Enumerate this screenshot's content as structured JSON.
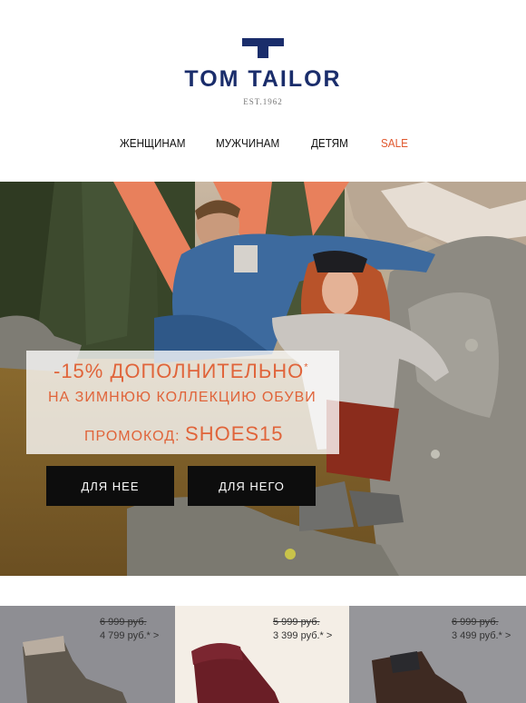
{
  "brand": {
    "name": "TOM TAILOR",
    "established": "EST.1962"
  },
  "nav": {
    "women": "ЖЕНЩИНАМ",
    "men": "МУЖЧИНАМ",
    "kids": "ДЕТЯМ",
    "sale": "SALE"
  },
  "promo": {
    "headline": "-15% ДОПОЛНИТЕЛЬНО",
    "asterisk": "*",
    "subline": "НА ЗИМНЮЮ КОЛЛЕКЦИЮ ОБУВИ",
    "code_label": "ПРОМОКОД:",
    "code": "SHOES15"
  },
  "buttons": {
    "for_her": "ДЛЯ НЕЕ",
    "for_him": "ДЛЯ НЕГО"
  },
  "products": [
    {
      "old_price": "6 999 руб.",
      "new_price": "4 799 руб.* >"
    },
    {
      "old_price": "5 999 руб.",
      "new_price": "3 399 руб.* >"
    },
    {
      "old_price": "6 999 руб.",
      "new_price": "3 499 руб.* >"
    }
  ],
  "colors": {
    "brand_navy": "#1a2d6b",
    "accent_orange": "#e0582e",
    "button_black": "#0d0d0d"
  }
}
